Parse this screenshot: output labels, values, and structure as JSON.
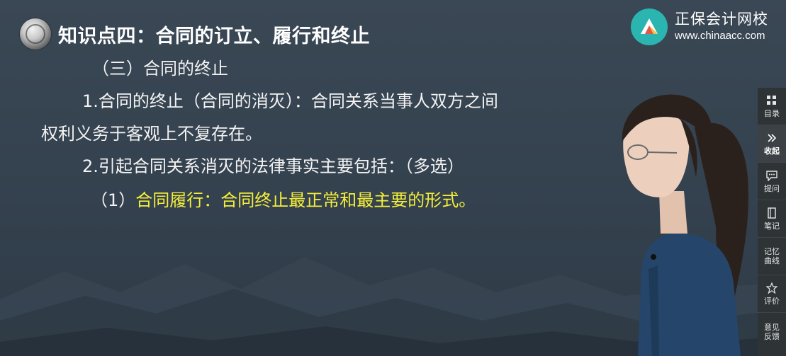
{
  "header": {
    "title": "知识点四：合同的订立、履行和终止"
  },
  "brand": {
    "name": "正保会计网校",
    "url": "www.chinaacc.com",
    "logo_color": "#2bb5b0"
  },
  "content": {
    "section": "（三）合同的终止",
    "item1_line1": "1.合同的终止（合同的消灭）：合同关系当事人双方之间",
    "item1_line2": "权利义务于客观上不复存在。",
    "item2": "2.引起合同关系消灭的法律事实主要包括：（多选）",
    "sub1_prefix": "（1）",
    "sub1_text": "合同履行：合同终止最正常和最主要的形式。",
    "highlight_color": "#f4ee3a"
  },
  "sidebar": {
    "items": [
      {
        "label": "目录",
        "icon": "grid-icon"
      },
      {
        "label": "收起",
        "icon": "double-chevron-right-icon"
      },
      {
        "label": "提问",
        "icon": "chat-bubble-icon"
      },
      {
        "label": "笔记",
        "icon": "notebook-icon"
      },
      {
        "label": "记忆曲线",
        "icon": "none"
      },
      {
        "label": "评价",
        "icon": "star-icon"
      },
      {
        "label": "意见反馈",
        "icon": "none"
      }
    ]
  }
}
